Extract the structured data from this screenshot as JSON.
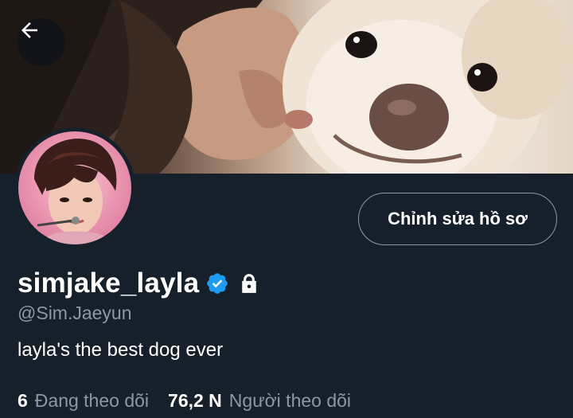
{
  "profile": {
    "display_name": "simjake_layla",
    "handle": "@Sim.Jaeyun",
    "bio": "layla's the best dog ever",
    "edit_button_label": "Chỉnh sửa hồ sơ",
    "verified": true,
    "protected": true
  },
  "stats": {
    "following_count": "6",
    "following_label": "Đang theo dõi",
    "followers_count": "76,2 N",
    "followers_label": "Người theo dõi"
  },
  "icons": {
    "back": "arrow-left-icon",
    "verified": "verified-badge-icon",
    "lock": "lock-icon"
  },
  "colors": {
    "background": "#15202b",
    "secondary_text": "#8b98a5",
    "verified_blue": "#1d9bf0",
    "button_border": "#8b98a5"
  }
}
